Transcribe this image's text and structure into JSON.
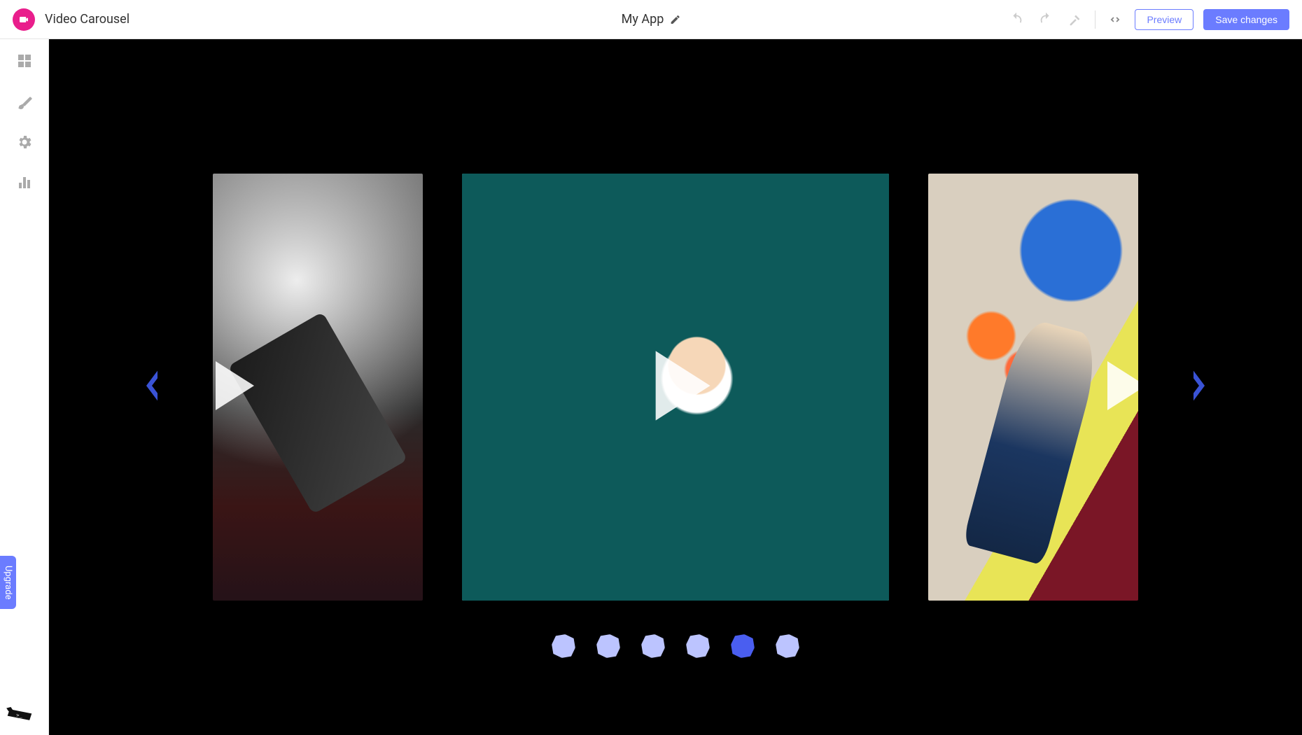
{
  "header": {
    "app_name": "Video Carousel",
    "project_title": "My App",
    "preview_label": "Preview",
    "save_label": "Save changes"
  },
  "leftrail": {
    "upgrade_label": "Upgrade"
  },
  "carousel": {
    "dot_count": 6,
    "active_index": 4
  },
  "colors": {
    "accent": "#6b7cff",
    "brand": "#e91e8c",
    "arrow": "#3a53d6"
  }
}
